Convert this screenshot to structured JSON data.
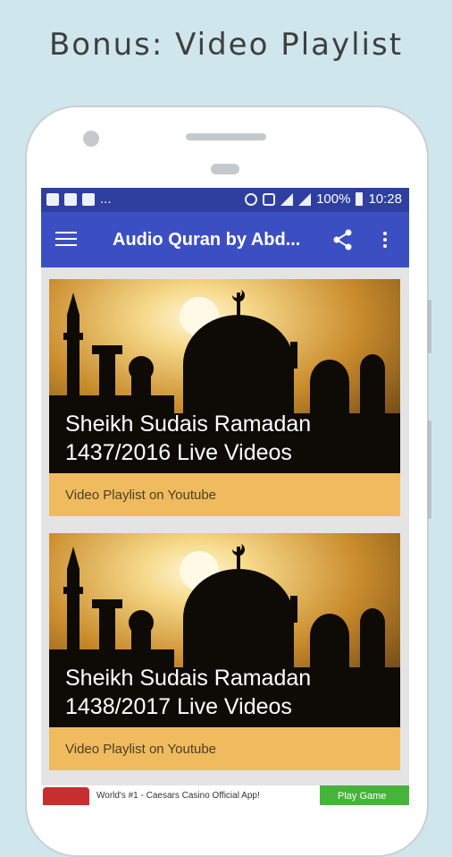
{
  "headline": "Bonus: Video Playlist",
  "status_bar": {
    "battery": "100%",
    "time": "10:28",
    "ellipsis": "..."
  },
  "toolbar": {
    "title": "Audio Quran by Abd..."
  },
  "cards": [
    {
      "title_line1": "Sheikh Sudais Ramadan",
      "title_line2": "1437/2016 Live Videos",
      "subtitle": "Video Playlist on Youtube"
    },
    {
      "title_line1": "Sheikh Sudais Ramadan",
      "title_line2": "1438/2017 Live Videos",
      "subtitle": "Video Playlist on Youtube"
    }
  ],
  "ad": {
    "text": "World's #1 - Caesars Casino Official App!",
    "button": "Play Game"
  },
  "colors": {
    "background": "#cfe6ec",
    "toolbar": "#3c4fc2",
    "status_bar": "#2f3fa0",
    "card_footer": "#f0bb5e"
  }
}
